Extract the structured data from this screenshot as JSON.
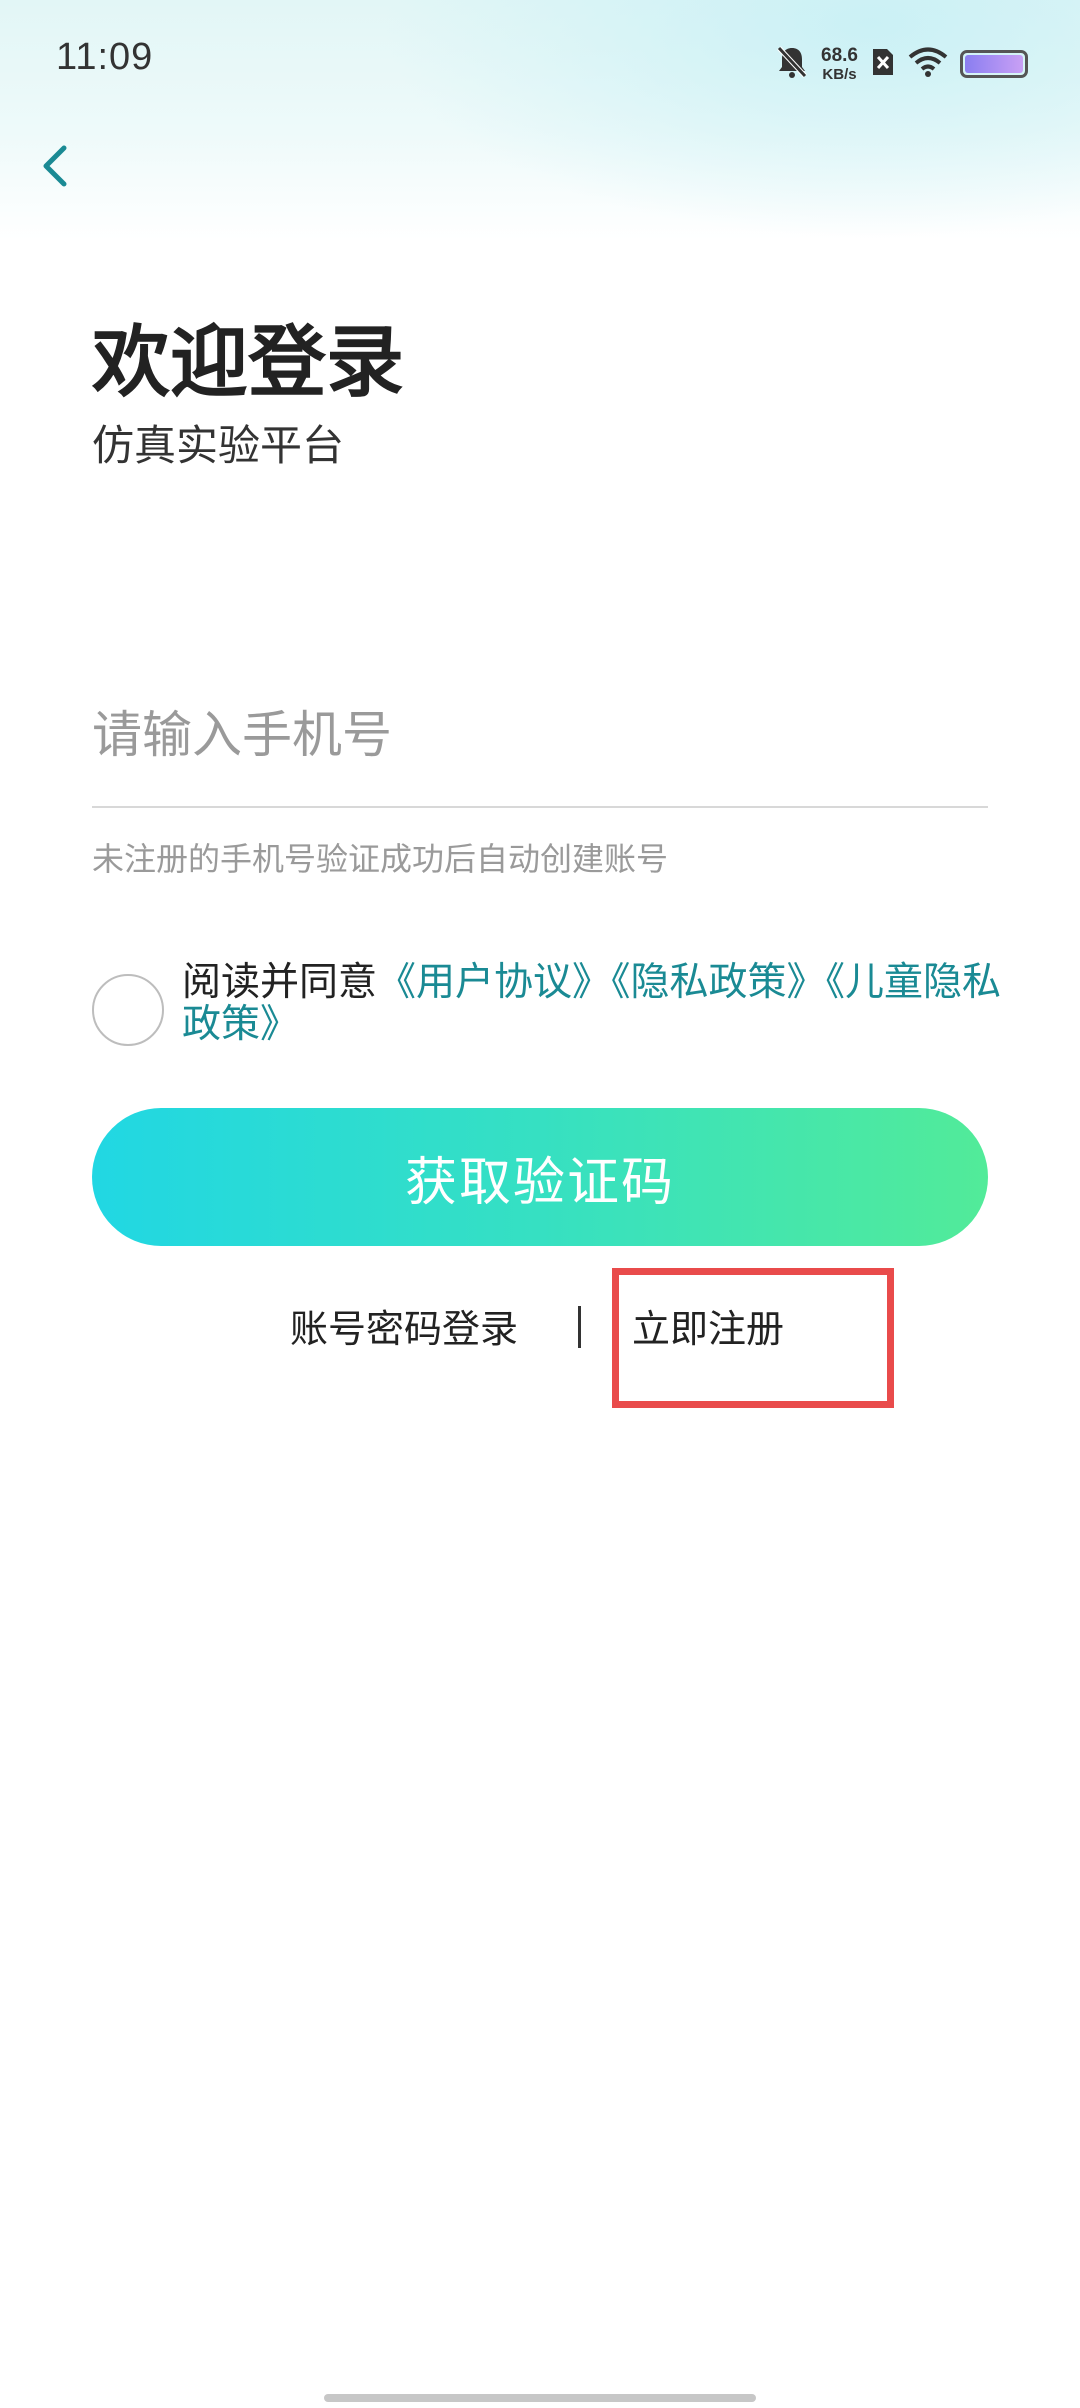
{
  "status_bar": {
    "time": "11:09",
    "net_speed_value": "68.6",
    "net_speed_unit": "KB/s",
    "icons": [
      "bell-muted-icon",
      "sim-x-icon",
      "wifi-icon",
      "battery-icon"
    ]
  },
  "nav": {
    "back_icon": "chevron-left-icon"
  },
  "header": {
    "title": "欢迎登录",
    "subtitle": "仿真实验平台"
  },
  "form": {
    "phone_placeholder": "请输入手机号",
    "phone_value": "",
    "hint": "未注册的手机号验证成功后自动创建账号"
  },
  "agreement": {
    "checked": false,
    "prefix": "阅读并同意",
    "user_agreement": "《用户协议》",
    "privacy_policy": "《隐私政策》",
    "children_privacy_policy": "《儿童隐私政策》"
  },
  "actions": {
    "get_code": "获取验证码",
    "password_login": "账号密码登录",
    "separator": "|",
    "register": "立即注册"
  },
  "colors": {
    "accent": "#1a8a94",
    "button_gradient_start": "#21d7e3",
    "button_gradient_end": "#52eb99",
    "highlight": "#e94b4b"
  }
}
